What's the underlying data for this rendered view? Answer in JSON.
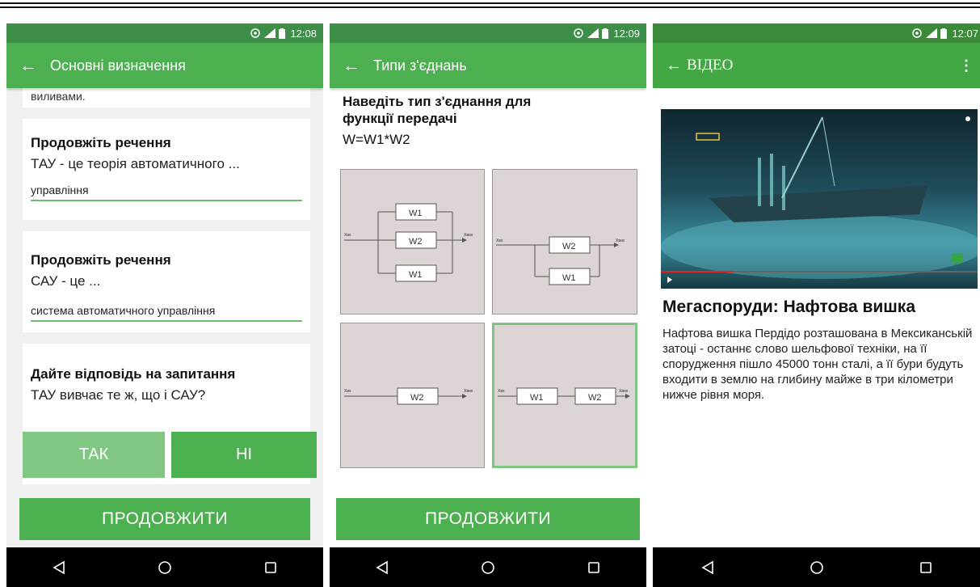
{
  "time_screens": [
    "12:08",
    "12:09",
    "12:07"
  ],
  "screen1": {
    "title": "Основні визначення",
    "cut_text": "виливами.",
    "q1": {
      "heading": "Продовжіть речення",
      "text": "ТАУ - це теорія автоматичного ...",
      "answer": "управління"
    },
    "q2": {
      "heading": "Продовжіть речення",
      "text": "САУ - це ...",
      "answer": "система автоматичного управління"
    },
    "q3": {
      "heading": "Дайте відповідь на запитання",
      "text": "ТАУ вивчає те ж, що і САУ?"
    },
    "yes_label": "ТАК",
    "no_label": "НІ",
    "continue_label": "ПРОДОВЖИТИ"
  },
  "screen2": {
    "title": "Типи з'єднань",
    "question": "Наведіть тип з'єднання для функції передачі",
    "formula": "W=W1*W2",
    "in_label": "Xвх",
    "out_label": "Хвих",
    "blocks": {
      "w1": "W1",
      "w2": "W2"
    },
    "continue_label": "ПРОДОВЖИТИ"
  },
  "screen3": {
    "title": "ВІДЕО",
    "video_title": "Мегаспоруди: Нафтова вишка",
    "description": "Нафтова вишка Пердідо розташована в Мексиканській затоці - останнє слово шельфової техніки, на її спорудження пішло 45000 тонн сталі, а її бури будуть входити в землю на глибину майже в три кілометри нижче рівня моря."
  },
  "icons": [
    "wifi-icon",
    "signal-icon",
    "battery-icon",
    "back-arrow-icon",
    "more-vert-icon",
    "nav-back-icon",
    "nav-home-icon",
    "nav-recents-icon"
  ],
  "colors": {
    "accent": "#4caf50",
    "status": "#3d8f48",
    "yes_button": "#81c784",
    "video_bg": "#2a5a6a"
  }
}
